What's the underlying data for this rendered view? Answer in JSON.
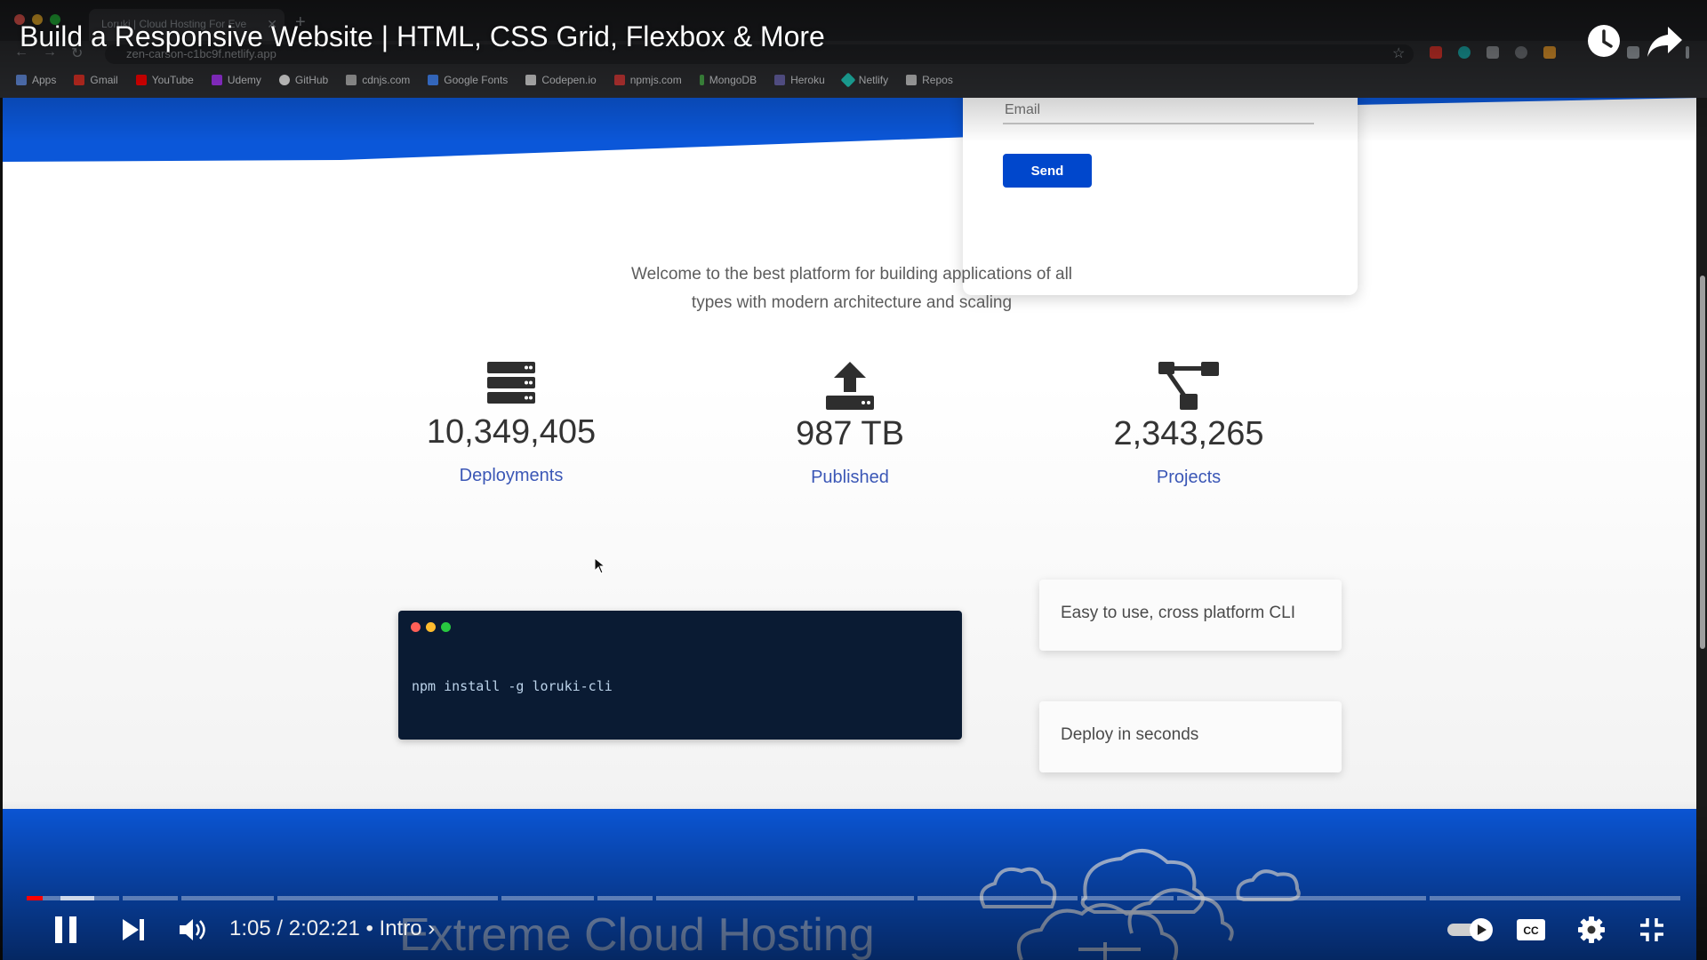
{
  "video": {
    "title": "Build a Responsive Website | HTML, CSS Grid, Flexbox & More",
    "time_display": "1:05 / 2:02:21",
    "chapter": "• Intro ›",
    "progress_fraction": 0.009
  },
  "browser": {
    "tab_title": "Loruki | Cloud Hosting For Eve",
    "url": "zen-carson-c1bc9f.netlify.app",
    "bookmarks": [
      "Apps",
      "Gmail",
      "YouTube",
      "Udemy",
      "GitHub",
      "cdnjs.com",
      "Google Fonts",
      "Codepen.io",
      "npmjs.com",
      "MongoDB",
      "Heroku",
      "Netlify",
      "Repos"
    ]
  },
  "site": {
    "form": {
      "email_placeholder": "Email",
      "send_label": "Send"
    },
    "welcome_line1": "Welcome to the best platform for building applications of all",
    "welcome_line2": "types with modern architecture and scaling",
    "stats": [
      {
        "value": "10,349,405",
        "label": "Deployments",
        "icon": "server-icon"
      },
      {
        "value": "987 TB",
        "label": "Published",
        "icon": "upload-icon"
      },
      {
        "value": "2,343,265",
        "label": "Projects",
        "icon": "project-diagram-icon"
      }
    ],
    "terminal_command": "npm install -g loruki-cli",
    "features": [
      "Easy to use, cross platform CLI",
      "Deploy in seconds"
    ],
    "footer_heading": "Extreme Cloud Hosting"
  },
  "colors": {
    "brand_blue": "#0047cc",
    "footer_blue": "#0b57d9",
    "terminal_bg": "#0a1b33",
    "progress_red": "#ff0000"
  }
}
